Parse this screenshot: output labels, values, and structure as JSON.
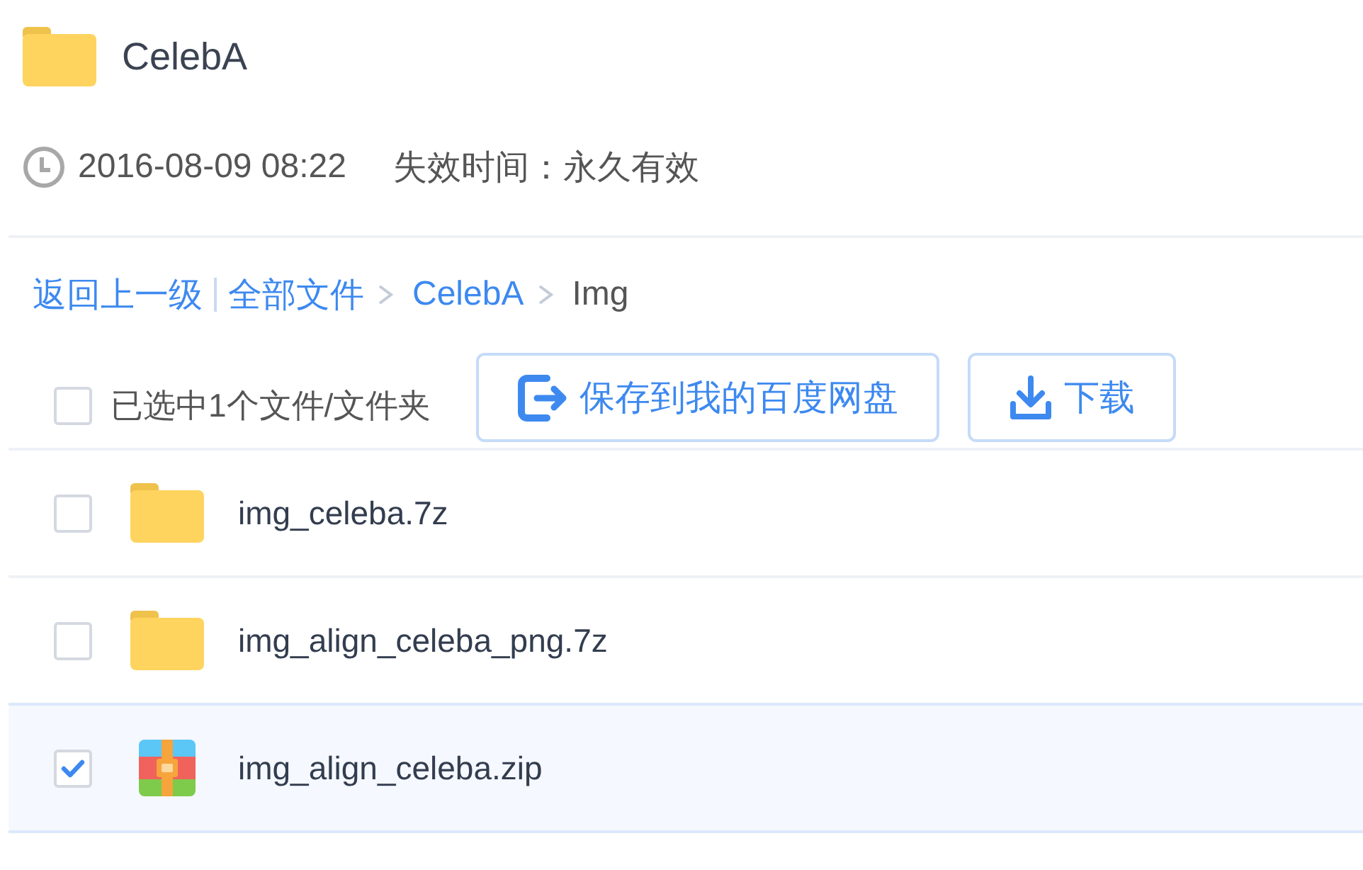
{
  "folder": {
    "title": "CelebA",
    "date": "2016-08-09 08:22",
    "expiry": "失效时间：永久有效"
  },
  "breadcrumb": {
    "back": "返回上一级",
    "items": [
      {
        "label": "全部文件",
        "current": false
      },
      {
        "label": "CelebA",
        "current": false
      },
      {
        "label": "Img",
        "current": true
      }
    ]
  },
  "toolbar": {
    "select_all": {
      "label": "已选中1个文件/文件夹",
      "checked": false
    },
    "buttons": [
      {
        "kind": "save",
        "label": "保存到我的百度网盘"
      },
      {
        "kind": "download",
        "label": "下载"
      }
    ]
  },
  "files": [
    {
      "name": "img_celeba.7z",
      "kind": "folder",
      "selected": false
    },
    {
      "name": "img_align_celeba_png.7z",
      "kind": "folder",
      "selected": false
    },
    {
      "name": "img_align_celeba.zip",
      "kind": "archive",
      "selected": true
    }
  ]
}
